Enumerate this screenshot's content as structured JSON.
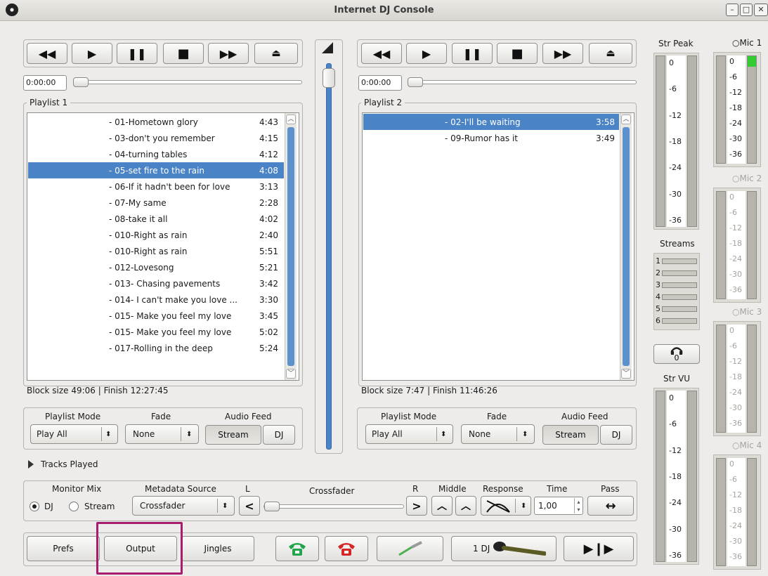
{
  "window": {
    "title": "Internet DJ Console"
  },
  "players": [
    {
      "time": "0:00:00",
      "playlist_title": "Playlist 1",
      "tracks": [
        {
          "name": "- 01-Hometown glory",
          "time": "4:43"
        },
        {
          "name": "- 03-don't you remember",
          "time": "4:15"
        },
        {
          "name": "- 04-turning tables",
          "time": "4:12"
        },
        {
          "name": "- 05-set fire to the rain",
          "time": "4:08"
        },
        {
          "name": "- 06-If it hadn't been for love",
          "time": "3:13"
        },
        {
          "name": "- 07-My same",
          "time": "2:28"
        },
        {
          "name": "- 08-take it all",
          "time": "4:02"
        },
        {
          "name": "- 010-Right as rain",
          "time": "2:40"
        },
        {
          "name": "- 010-Right as rain",
          "time": "5:51"
        },
        {
          "name": "- 012-Lovesong",
          "time": "5:21"
        },
        {
          "name": "- 013- Chasing pavements",
          "time": "3:42"
        },
        {
          "name": "- 014- I can't make you love ...",
          "time": "3:30"
        },
        {
          "name": "- 015- Make you feel my love",
          "time": "3:45"
        },
        {
          "name": "- 015- Make you feel my love",
          "time": "5:02"
        },
        {
          "name": "- 017-Rolling in the deep",
          "time": "5:24"
        }
      ],
      "selected_index": 3,
      "block_info": "Block size 49:06 | Finish 12:27:45",
      "mode_label": "Playlist Mode",
      "mode_value": "Play All",
      "fade_label": "Fade",
      "fade_value": "None",
      "feed_label": "Audio Feed",
      "stream_btn": "Stream",
      "dj_btn": "DJ"
    },
    {
      "time": "0:00:00",
      "playlist_title": "Playlist 2",
      "tracks": [
        {
          "name": "- 02-I'll be waiting",
          "time": "3:58"
        },
        {
          "name": "- 09-Rumor has it",
          "time": "3:49"
        }
      ],
      "selected_index": 0,
      "block_info": "Block size  7:47 | Finish 11:46:26",
      "mode_label": "Playlist Mode",
      "mode_value": "Play All",
      "fade_label": "Fade",
      "fade_value": "None",
      "feed_label": "Audio Feed",
      "stream_btn": "Stream",
      "dj_btn": "DJ"
    }
  ],
  "tracks_played": "Tracks Played",
  "mixer": {
    "monitor_label": "Monitor Mix",
    "monitor_dj": "DJ",
    "monitor_stream": "Stream",
    "metadata_label": "Metadata Source",
    "metadata_value": "Crossfader",
    "l_label": "L",
    "crossfader_label": "Crossfader",
    "r_label": "R",
    "middle_label": "Middle",
    "response_label": "Response",
    "time_label": "Time",
    "time_value": "1,00",
    "pass_label": "Pass",
    "pass_symbol": "↔"
  },
  "bottom": {
    "prefs": "Prefs",
    "output": "Output",
    "jingles": "Jingles",
    "dj_count": "1 DJ"
  },
  "meters": {
    "str_peak": "Str Peak",
    "scale": [
      "0",
      "-6",
      "-12",
      "-18",
      "-24",
      "-30",
      "-36"
    ],
    "streams_label": "Streams",
    "stream_nums": [
      "1",
      "2",
      "3",
      "4",
      "5",
      "6"
    ],
    "listeners": "0",
    "str_vu": "Str VU",
    "mics": [
      "Mic 1",
      "Mic 2",
      "Mic 3",
      "Mic 4"
    ],
    "mic1_level": 0.1,
    "mic_active_color": "#33cc33"
  },
  "colors": {
    "selection": "#4a84c6",
    "highlight": "#a81c6e",
    "phone_green": "#21a44a",
    "phone_red": "#d42626"
  }
}
